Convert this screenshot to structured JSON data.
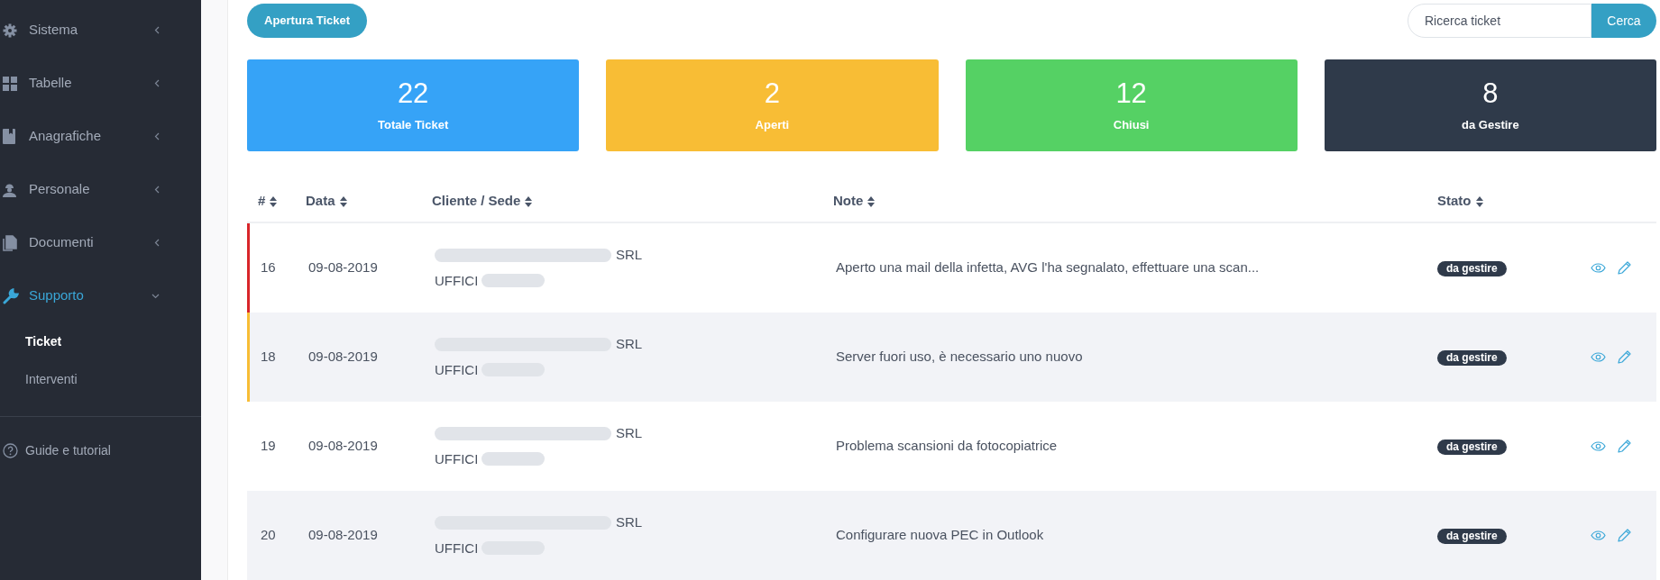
{
  "sidebar": {
    "items": [
      {
        "label": "Sistema",
        "expanded": false,
        "selected": false
      },
      {
        "label": "Tabelle",
        "expanded": false,
        "selected": false
      },
      {
        "label": "Anagrafiche",
        "expanded": false,
        "selected": false
      },
      {
        "label": "Personale",
        "expanded": false,
        "selected": false
      },
      {
        "label": "Documenti",
        "expanded": false,
        "selected": false
      },
      {
        "label": "Supporto",
        "expanded": true,
        "selected": true,
        "children": [
          {
            "label": "Ticket",
            "selected": true
          },
          {
            "label": "Interventi",
            "selected": false
          }
        ]
      }
    ],
    "footer": {
      "label": "Guide e tutorial"
    }
  },
  "toolbar": {
    "new_button": "Apertura Ticket",
    "search": {
      "placeholder": "Ricerca ticket"
    },
    "search_button": "Cerca"
  },
  "stats": [
    {
      "value": "22",
      "label": "Totale Ticket",
      "color": "#36a3f7"
    },
    {
      "value": "2",
      "label": "Aperti",
      "color": "#f8bd35"
    },
    {
      "value": "12",
      "label": "Chiusi",
      "color": "#55d164"
    },
    {
      "value": "8",
      "label": "da Gestire",
      "color": "#2f3a4a"
    }
  ],
  "table": {
    "columns": [
      "#",
      "Data",
      "Cliente / Sede",
      "Note",
      "Stato"
    ],
    "rows": [
      {
        "id": "16",
        "date": "09-08-2019",
        "client": "SRL",
        "site": "UFFICI",
        "note": "Aperto una mail della infetta, AVG l'ha segnalato, effettuare una scan...",
        "status": "da gestire",
        "color": "#d8262a"
      },
      {
        "id": "18",
        "date": "09-08-2019",
        "client": "SRL",
        "site": "UFFICI",
        "note": "Server fuori uso, è necessario uno nuovo",
        "status": "da gestire",
        "color": "#f8bd35"
      },
      {
        "id": "19",
        "date": "09-08-2019",
        "client": "SRL",
        "site": "UFFICI",
        "note": "Problema scansioni da fotocopiatrice",
        "status": "da gestire"
      },
      {
        "id": "20",
        "date": "09-08-2019",
        "client": "SRL",
        "site": "UFFICI",
        "note": "Configurare nuova PEC in Outlook",
        "status": "da gestire"
      }
    ]
  }
}
